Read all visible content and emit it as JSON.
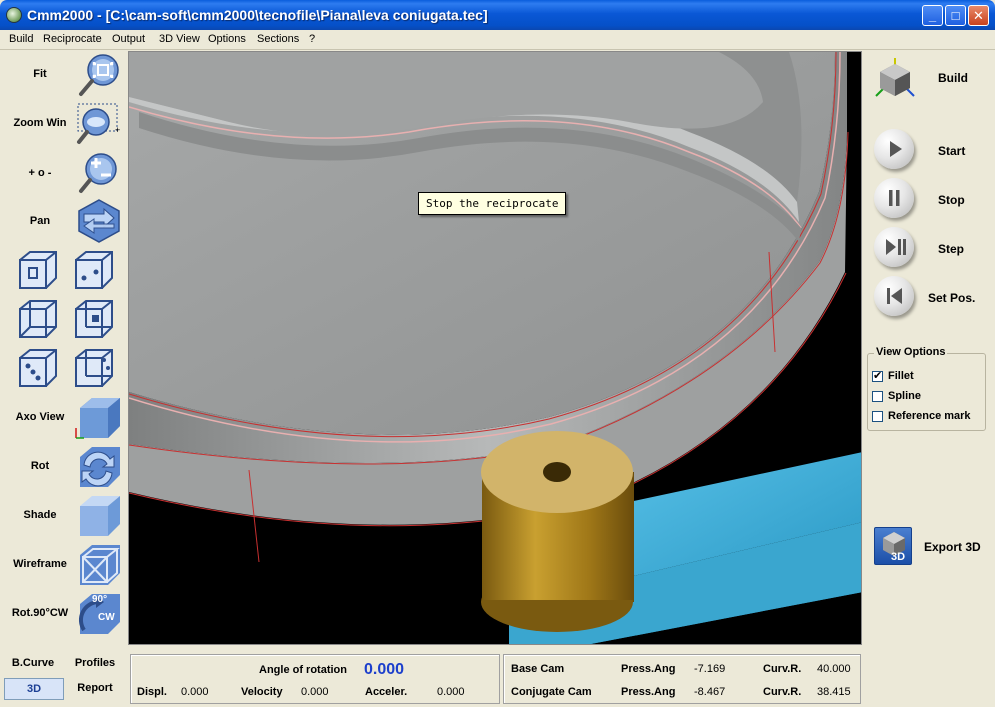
{
  "window": {
    "title": "Cmm2000 - [C:\\cam-soft\\cmm2000\\tecnofile\\Piana\\leva coniugata.tec]",
    "min_symbol": "_",
    "max_symbol": "□",
    "close_symbol": "✕"
  },
  "menu": [
    "Build",
    "Reciprocate",
    "Output",
    "3D View",
    "Options",
    "Sections",
    "?"
  ],
  "left_tools": {
    "fit": "Fit",
    "zoom_win": "Zoom Win",
    "zoom_pm": "+ o -",
    "pan": "Pan",
    "axo_view": "Axo View",
    "rot": "Rot",
    "shade": "Shade",
    "wireframe": "Wireframe",
    "rot90": "Rot.90°CW",
    "rot90_icon_top": "90°",
    "rot90_icon_bottom": "CW"
  },
  "tooltip": "Stop the reciprocate",
  "right_panel": {
    "build": "Build",
    "start": "Start",
    "stop": "Stop",
    "step": "Step",
    "set_pos": "Set Pos.",
    "view_options_title": "View Options",
    "options": [
      {
        "label": "Fillet",
        "checked": true
      },
      {
        "label": "Spline",
        "checked": false
      },
      {
        "label": "Reference mark",
        "checked": false
      }
    ],
    "export": "Export 3D",
    "export_icon_text": "3D"
  },
  "bottom_left": {
    "b_curve": "B.Curve",
    "profiles": "Profiles",
    "three_d": "3D",
    "report": "Report"
  },
  "status": {
    "angle_label": "Angle of rotation",
    "angle_value": "0.000",
    "displ_label": "Displ.",
    "displ_value": "0.000",
    "velocity_label": "Velocity",
    "velocity_value": "0.000",
    "acceler_label": "Acceler.",
    "acceler_value": "0.000",
    "base_cam_label": "Base Cam",
    "base_press_label": "Press.Ang",
    "base_press_value": "-7.169",
    "base_curv_label": "Curv.R.",
    "base_curv_value": "40.000",
    "conj_cam_label": "Conjugate Cam",
    "conj_press_label": "Press.Ang",
    "conj_press_value": "-8.467",
    "conj_curv_label": "Curv.R.",
    "conj_curv_value": "38.415"
  },
  "colors": {
    "titlebar": "#0a58d6",
    "face": "#ece9d8",
    "viewport_bg": "#000000",
    "cam_gray": "#9a9c9c",
    "follower_gold": "#c9a030",
    "arm_blue": "#3aa6cf",
    "angle_value": "#1c3fcc"
  }
}
